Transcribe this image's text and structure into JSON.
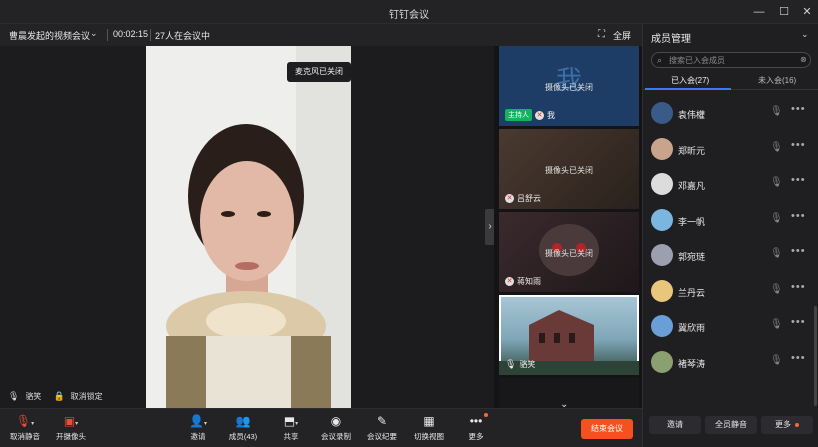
{
  "window": {
    "title": "钉钉会议",
    "minimize_icon": "—",
    "maximize_icon": "☐",
    "close_icon": "✕"
  },
  "meeting": {
    "name": "曹晨发起的视频会议",
    "duration": "00:02:15",
    "participants_text": "27人在会议中",
    "fullscreen_label": "全屏"
  },
  "main_video": {
    "toast": "麦克风已关闭",
    "speaker_name": "骆笑",
    "unlock_label": "取消锁定"
  },
  "thumbnails": [
    {
      "name": "我",
      "status": "摄像头已关闭",
      "host_badge": "主持人",
      "avatar_char": "我",
      "bg": "#1d3d66"
    },
    {
      "name": "吕舒云",
      "status": "摄像头已关闭",
      "bg": "#3a2f28"
    },
    {
      "name": "蒋知雨",
      "status": "摄像头已关闭",
      "bg": "#2a2224"
    },
    {
      "name": "骆笑",
      "status": "",
      "bg": "#7fa7b8"
    }
  ],
  "panel": {
    "title": "成员管理",
    "search_placeholder": "搜索已入会成员",
    "tab_joined": "已入会(27)",
    "tab_not_joined": "未入会(16)",
    "members": [
      {
        "name": "袁伟權",
        "color": "#3a5a8a"
      },
      {
        "name": "郑昕元",
        "color": "#c9a48c"
      },
      {
        "name": "邓嘉凡",
        "color": "#dcdcdc"
      },
      {
        "name": "李一帆",
        "color": "#7ab6e0"
      },
      {
        "name": "郭宛琏",
        "color": "#9aa0b0"
      },
      {
        "name": "兰丹云",
        "color": "#e8c67c"
      },
      {
        "name": "冀欣雨",
        "color": "#6a9ed6"
      },
      {
        "name": "褚琴涛",
        "color": "#8aa070"
      }
    ],
    "invite_label": "邀请",
    "mute_all_label": "全员静音",
    "more_label": "更多"
  },
  "toolbar": {
    "unmute_label": "取消静音",
    "camera_label": "开摄像头",
    "invite_label": "邀请",
    "members_label": "成员(43)",
    "share_label": "共享",
    "record_label": "会议录制",
    "minutes_label": "会议纪要",
    "switch_view_label": "切换视图",
    "more_label": "更多",
    "end_label": "结束会议"
  },
  "colors": {
    "end_button": "#f4511e",
    "host_badge": "#12b361",
    "tab_accent": "#3a7bf5"
  }
}
